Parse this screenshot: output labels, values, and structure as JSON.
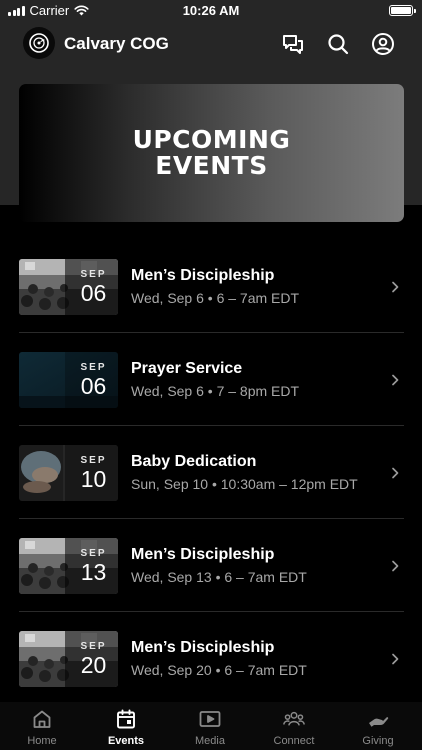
{
  "status_bar": {
    "carrier": "Carrier",
    "time": "10:26 AM"
  },
  "app": {
    "title": "Calvary COG"
  },
  "header_icons": [
    "chat-bubbles-icon",
    "search-icon",
    "account-icon"
  ],
  "banner": {
    "text": "UPCOMING EVENTS"
  },
  "events": [
    {
      "month": "SEP",
      "day": "06",
      "title": "Men’s Discipleship",
      "meta": "Wed, Sep 6 • 6 – 7am EDT",
      "thumb": "congregation"
    },
    {
      "month": "SEP",
      "day": "06",
      "title": "Prayer Service",
      "meta": "Wed, Sep 6 • 7 – 8pm EDT",
      "thumb": "dark-teal"
    },
    {
      "month": "SEP",
      "day": "10",
      "title": "Baby Dedication",
      "meta": "Sun, Sep 10 • 10:30am – 12pm EDT",
      "thumb": "baby-hands"
    },
    {
      "month": "SEP",
      "day": "13",
      "title": "Men’s Discipleship",
      "meta": "Wed, Sep 13 • 6 – 7am EDT",
      "thumb": "congregation"
    },
    {
      "month": "SEP",
      "day": "20",
      "title": "Men’s Discipleship",
      "meta": "Wed, Sep 20 • 6 – 7am EDT",
      "thumb": "congregation"
    }
  ],
  "tabs": [
    {
      "label": "Home",
      "icon": "home-icon",
      "active": false
    },
    {
      "label": "Events",
      "icon": "calendar-icon",
      "active": true
    },
    {
      "label": "Media",
      "icon": "play-icon",
      "active": false
    },
    {
      "label": "Connect",
      "icon": "people-icon",
      "active": false
    },
    {
      "label": "Giving",
      "icon": "giving-hand-icon",
      "active": false
    }
  ],
  "colors": {
    "background": "#000000",
    "header_bg": "#262626",
    "secondary_text": "#a8a8a8",
    "inactive_tab": "#8a8a8a"
  }
}
